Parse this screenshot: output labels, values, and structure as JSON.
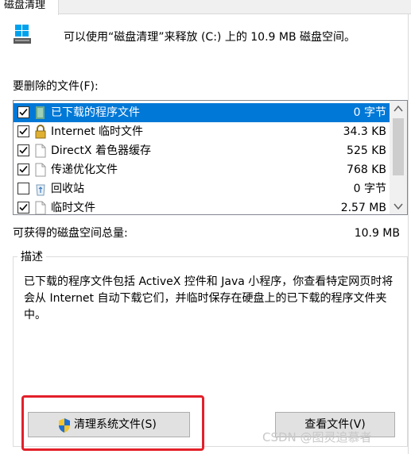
{
  "tab": {
    "label": "磁盘清理"
  },
  "header": {
    "text": "可以使用“磁盘清理”来释放  (C:) 上的 10.9 MB 磁盘空间。"
  },
  "files": {
    "label": "要删除的文件(F):",
    "items": [
      {
        "name": "已下载的程序文件",
        "size": "0 字节",
        "checked": true,
        "selected": true,
        "icon": "downloaded-program-icon"
      },
      {
        "name": "Internet 临时文件",
        "size": "34.3 KB",
        "checked": true,
        "selected": false,
        "icon": "lock-icon"
      },
      {
        "name": "DirectX 着色器缓存",
        "size": "525 KB",
        "checked": true,
        "selected": false,
        "icon": "blank-file-icon"
      },
      {
        "name": "传递优化文件",
        "size": "768 KB",
        "checked": true,
        "selected": false,
        "icon": "blank-file-icon"
      },
      {
        "name": "回收站",
        "size": "0 字节",
        "checked": false,
        "selected": false,
        "icon": "recycle-bin-icon"
      },
      {
        "name": "临时文件",
        "size": "2.57 MB",
        "checked": true,
        "selected": false,
        "icon": "blank-file-icon"
      }
    ]
  },
  "total": {
    "label": "可获得的磁盘空间总量:",
    "value": "10.9 MB"
  },
  "description": {
    "legend": "描述",
    "text": "已下载的程序文件包括 ActiveX 控件和 Java 小程序，你查看特定网页时将会从 Internet 自动下载它们，并临时保存在硬盘上的已下载的程序文件夹中。"
  },
  "buttons": {
    "clean_system": "清理系统文件(S)",
    "view_files": "查看文件(V)"
  },
  "watermark": "CSDN @图灵追慕者",
  "colors": {
    "selection": "#0078d7",
    "highlight_border": "#e3202a",
    "window_accent": "#00a2ed"
  }
}
